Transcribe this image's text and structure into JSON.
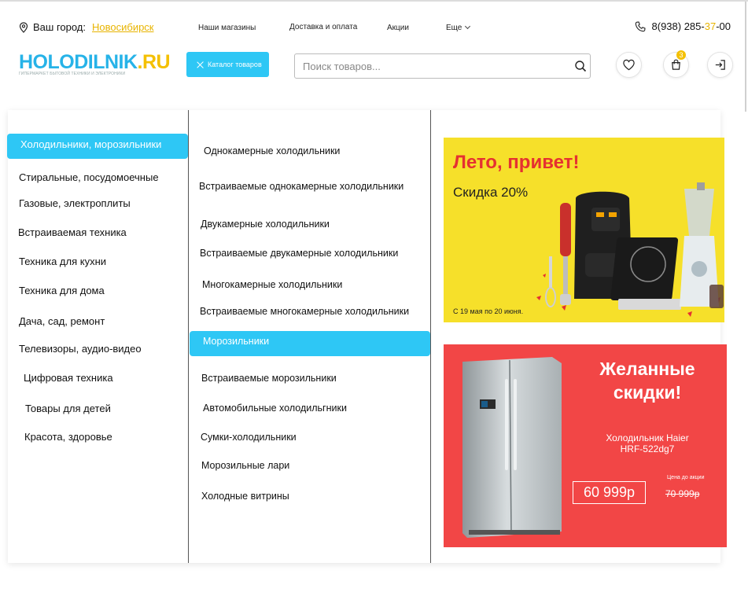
{
  "header": {
    "city_label": "Ваш город:",
    "city_value": "Новосибирск",
    "nav": [
      "Наши магазины",
      "Доставка и оплата",
      "Акции",
      "Еще"
    ],
    "phone_prefix": "8(938) 285-",
    "phone_highlight": "37",
    "phone_suffix": "-00",
    "logo_main_a": "HOLODILNIK",
    "logo_main_b": ".RU",
    "logo_sub": "ГИПЕРМАРКЕТ БЫТОВОЙ ТЕХНИКИ И ЭЛЕКТРОНИКИ",
    "catalog_label": "Каталог товаров",
    "search_placeholder": "Поиск товаров...",
    "cart_count": "3",
    "icons": {
      "location": "location-pin-icon",
      "phone": "phone-icon",
      "search": "search-icon",
      "favorites": "heart-icon",
      "cart": "cart-icon",
      "login": "login-icon",
      "catalog": "close-icon"
    },
    "accent": "#2ec7f5",
    "brand_yellow": "#f4c000"
  },
  "categories": [
    "Холодильники, морозильники",
    "Стиральные, посудомоечные",
    "Газовые, электроплиты",
    "Встраиваемая техника",
    "Техника для кухни",
    "Техника для дома",
    "Дача, сад, ремонт",
    "Телевизоры, аудио-видео",
    "Цифровая техника",
    "Товары для детей",
    "Красота, здоровье"
  ],
  "subcategories": [
    "Однокамерные холодильники",
    "Встраиваемые однокамерные холодильники",
    "Двукамерные холодильники",
    "Встраиваемые двукамерные холодильники",
    "Многокамерные холодильники",
    "Встраиваемые многокамерные холодильники",
    "Морозильники",
    "Встраиваемые морозильники",
    "Автомобильные холодильгники",
    "Сумки-холодильники",
    "Морозильные лари",
    "Холодные витрины"
  ],
  "banner1": {
    "title": "Лето, привет!",
    "discount": "Скидка 20%",
    "period": "С 19 мая по 20 июня.",
    "bg": "#f6e02a",
    "title_color": "#e53131"
  },
  "banner2": {
    "heading_line1": "Желанные",
    "heading_line2": "скидки!",
    "model_line1": "Холодильник Haier",
    "model_line2": "HRF-522dg7",
    "price": "60 999р",
    "old_label": "Цена до акции",
    "old_price": "70 999р",
    "bg": "#f24646"
  }
}
